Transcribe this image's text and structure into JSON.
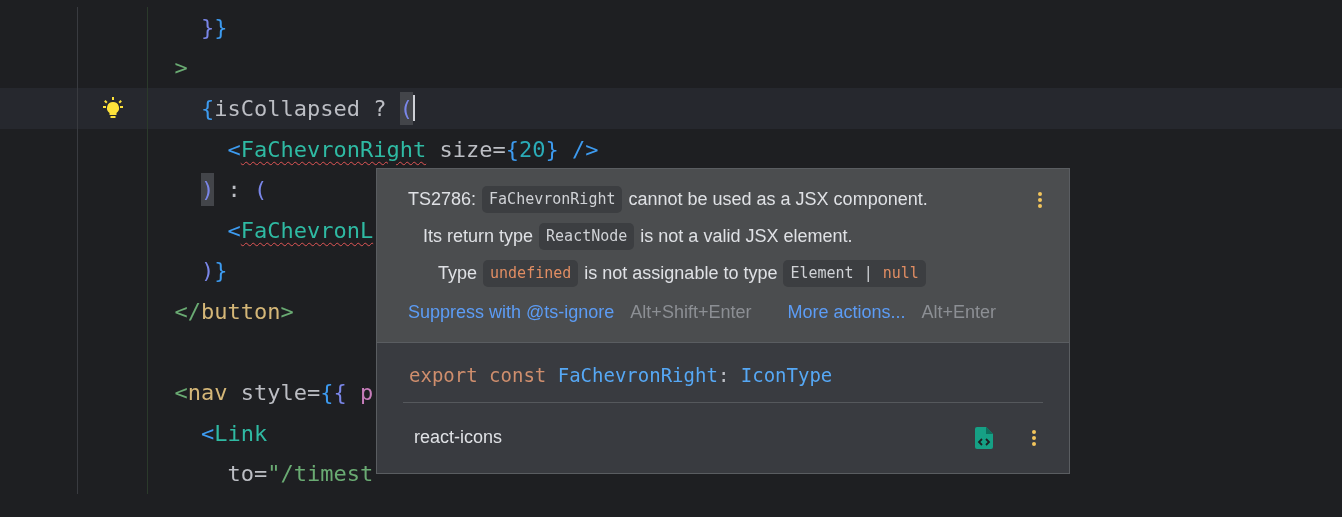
{
  "editor": {
    "lines": [
      {
        "current": false,
        "bulb": false,
        "tokens": [
          {
            "text": "    }",
            "kind": "brace2"
          },
          {
            "text": "}",
            "kind": "brace"
          }
        ]
      },
      {
        "current": false,
        "bulb": false,
        "tokens": [
          {
            "text": "  >",
            "kind": "tag"
          }
        ]
      },
      {
        "current": true,
        "bulb": true,
        "tokens": [
          {
            "text": "    {",
            "kind": "brace"
          },
          {
            "text": "isCollapsed ? ",
            "kind": "plain"
          },
          {
            "text": "(",
            "kind": "brace2",
            "matched": true,
            "caret": true
          }
        ]
      },
      {
        "current": false,
        "bulb": false,
        "tokens": [
          {
            "text": "      <",
            "kind": "brace"
          },
          {
            "text": "FaChevronRight",
            "kind": "component",
            "error": true
          },
          {
            "text": " size=",
            "kind": "plain"
          },
          {
            "text": "{",
            "kind": "brace"
          },
          {
            "text": "20",
            "kind": "number"
          },
          {
            "text": "}",
            "kind": "brace"
          },
          {
            "text": " />",
            "kind": "brace"
          }
        ]
      },
      {
        "current": false,
        "bulb": false,
        "tokens": [
          {
            "text": "    )",
            "kind": "brace2",
            "matched": true
          },
          {
            "text": " : ",
            "kind": "plain"
          },
          {
            "text": "(",
            "kind": "brace2"
          }
        ]
      },
      {
        "current": false,
        "bulb": false,
        "tokens": [
          {
            "text": "      <",
            "kind": "brace"
          },
          {
            "text": "FaChevronL",
            "kind": "component",
            "error": true
          }
        ]
      },
      {
        "current": false,
        "bulb": false,
        "tokens": [
          {
            "text": "    )",
            "kind": "brace2"
          },
          {
            "text": "}",
            "kind": "brace"
          }
        ]
      },
      {
        "current": false,
        "bulb": false,
        "tokens": [
          {
            "text": "  </",
            "kind": "tag"
          },
          {
            "text": "button",
            "kind": "tagname"
          },
          {
            "text": ">",
            "kind": "tag"
          }
        ]
      },
      {
        "current": false,
        "bulb": false
      },
      {
        "current": false,
        "bulb": false,
        "tokens": [
          {
            "text": "  <",
            "kind": "tag"
          },
          {
            "text": "nav",
            "kind": "tagname"
          },
          {
            "text": " style=",
            "kind": "plain"
          },
          {
            "text": "{",
            "kind": "brace"
          },
          {
            "text": "{ ",
            "kind": "brace2"
          },
          {
            "text": "p",
            "kind": "prop"
          }
        ]
      },
      {
        "current": false,
        "bulb": false,
        "tokens": [
          {
            "text": "    <",
            "kind": "brace"
          },
          {
            "text": "Link",
            "kind": "component"
          }
        ]
      },
      {
        "current": false,
        "bulb": false,
        "tokens": [
          {
            "text": "      to=",
            "kind": "plain"
          },
          {
            "text": "\"/timest",
            "kind": "string"
          }
        ]
      }
    ]
  },
  "popup": {
    "message": {
      "segments": [
        {
          "kind": "text",
          "text": "TS2786:"
        },
        {
          "kind": "code",
          "parts": [
            {
              "text": "FaChevronRight",
              "kind": "plain"
            }
          ]
        },
        {
          "kind": "text",
          "text": "cannot be used as a JSX component."
        }
      ],
      "children": [
        {
          "segments": [
            {
              "kind": "text",
              "text": "Its return type"
            },
            {
              "kind": "code",
              "parts": [
                {
                  "text": "ReactNode",
                  "kind": "plain"
                }
              ]
            },
            {
              "kind": "text",
              "text": "is not a valid JSX element."
            }
          ],
          "children": [
            {
              "segments": [
                {
                  "kind": "text",
                  "text": "Type"
                },
                {
                  "kind": "code",
                  "parts": [
                    {
                      "text": "undefined",
                      "kind": "keyword"
                    }
                  ]
                },
                {
                  "kind": "text",
                  "text": "is not assignable to type"
                },
                {
                  "kind": "code",
                  "parts": [
                    {
                      "text": "Element",
                      "kind": "plain"
                    },
                    {
                      "text": "|",
                      "kind": "plain"
                    },
                    {
                      "text": "null",
                      "kind": "keyword"
                    }
                  ]
                }
              ]
            }
          ]
        }
      ]
    },
    "actions": [
      {
        "label": "Suppress with @ts-ignore",
        "shortcut": "Alt+Shift+Enter"
      },
      {
        "label": "More actions...",
        "shortcut": "Alt+Enter"
      }
    ],
    "declaration": [
      {
        "text": "export ",
        "kind": "keyword"
      },
      {
        "text": "const ",
        "kind": "keyword"
      },
      {
        "text": "FaChevronRight",
        "kind": "ident"
      },
      {
        "text": ": ",
        "kind": "plain"
      },
      {
        "text": "IconType",
        "kind": "ident"
      }
    ],
    "source": "react-icons"
  }
}
